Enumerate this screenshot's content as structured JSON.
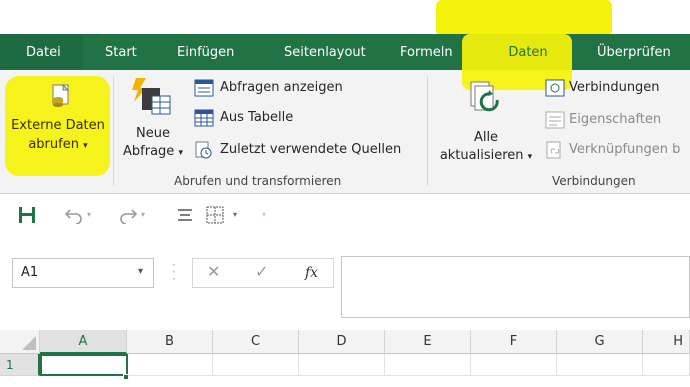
{
  "colors": {
    "accent": "#217346",
    "highlight": "#f4f20a",
    "ribbon_bg": "#f3f3f3"
  },
  "tabs": [
    {
      "label": "Datei",
      "name": "tab-datei"
    },
    {
      "label": "Start",
      "name": "tab-start"
    },
    {
      "label": "Einfügen",
      "name": "tab-einfuegen"
    },
    {
      "label": "Seitenlayout",
      "name": "tab-seitenlayout"
    },
    {
      "label": "Formeln",
      "name": "tab-formeln"
    },
    {
      "label": "Daten",
      "name": "tab-daten",
      "active": true
    },
    {
      "label": "Überprüfen",
      "name": "tab-ueberpruefen"
    }
  ],
  "ribbon": {
    "external_data": {
      "line1": "Externe Daten",
      "line2": "abrufen",
      "caret": "▾",
      "icon": "external-data-icon"
    },
    "new_query": {
      "line1": "Neue",
      "line2": "Abfrage",
      "caret": "▾",
      "icon": "new-query-icon"
    },
    "show_queries": {
      "label": "Abfragen anzeigen",
      "icon": "show-queries-icon"
    },
    "from_table": {
      "label": "Aus Tabelle",
      "icon": "table-icon"
    },
    "recent_sources": {
      "label": "Zuletzt verwendete Quellen",
      "icon": "recent-sources-icon"
    },
    "group_get_transform": "Abrufen und transformieren",
    "refresh_all": {
      "line1": "Alle",
      "line2": "aktualisieren",
      "caret": "▾",
      "icon": "refresh-all-icon"
    },
    "connections": {
      "label": "Verbindungen",
      "icon": "connections-icon"
    },
    "properties": {
      "label": "Eigenschaften",
      "icon": "properties-icon"
    },
    "edit_links": {
      "label": "Verknüpfungen b",
      "icon": "edit-links-icon"
    },
    "group_connections": "Verbindungen"
  },
  "qat": {
    "save_icon": "save-icon",
    "undo_icon": "undo-icon",
    "redo_icon": "redo-icon",
    "align_icon": "align-icon",
    "border_icon": "border-icon",
    "caret": "▾",
    "more_caret": "▾"
  },
  "formula_bar": {
    "name_box_value": "A1",
    "name_box_caret": "▾",
    "cancel_symbol": "✕",
    "enter_symbol": "✓",
    "fx_symbol": "fx",
    "formula_value": ""
  },
  "grid": {
    "columns": [
      "A",
      "B",
      "C",
      "D",
      "E",
      "F",
      "G",
      "H"
    ],
    "rows": [
      "1"
    ],
    "active_cell": "A1"
  }
}
